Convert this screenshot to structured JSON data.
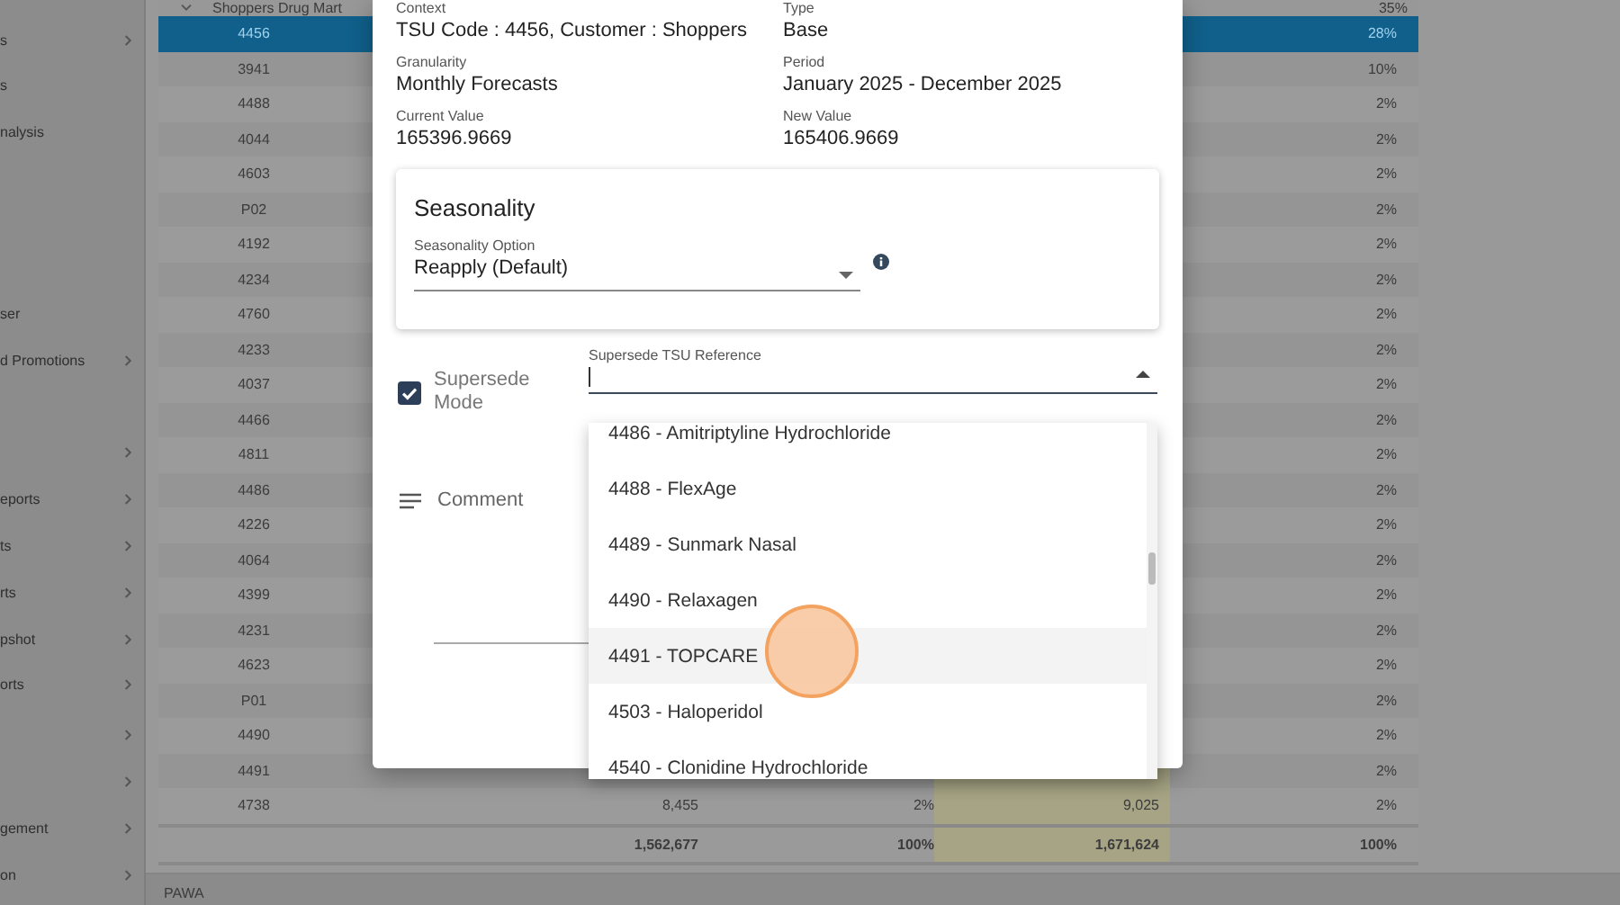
{
  "sidebar": {
    "items": [
      {
        "label": "s",
        "expandable": true
      },
      {
        "label": "s",
        "expandable": false
      },
      {
        "label": "nalysis",
        "expandable": false
      },
      {
        "label": "ser",
        "expandable": false
      },
      {
        "label": "d Promotions",
        "expandable": true
      },
      {
        "expandable": true
      },
      {
        "label": "eports",
        "expandable": true
      },
      {
        "label": "ts",
        "expandable": true
      },
      {
        "label": "rts",
        "expandable": true
      },
      {
        "label": "pshot",
        "expandable": true
      },
      {
        "label": "orts",
        "expandable": true
      },
      {
        "expandable": true
      },
      {
        "expandable": true
      },
      {
        "label": "gement",
        "expandable": true
      },
      {
        "label": "on",
        "expandable": true
      }
    ]
  },
  "table": {
    "group": {
      "name": "Shoppers Drug Mart",
      "share": "35%",
      "expanded": true
    },
    "rows": [
      {
        "code": "4456",
        "share": "28%",
        "selected": true
      },
      {
        "code": "3941",
        "share": "10%",
        "selected": false
      },
      {
        "code": "4488",
        "share": "2%",
        "selected": false
      },
      {
        "code": "4044",
        "share": "2%",
        "selected": false
      },
      {
        "code": "4603",
        "share": "2%",
        "selected": false
      },
      {
        "code": "P02",
        "share": "2%",
        "selected": false
      },
      {
        "code": "4192",
        "share": "2%",
        "selected": false
      },
      {
        "code": "4234",
        "share": "2%",
        "selected": false
      },
      {
        "code": "4760",
        "share": "2%",
        "selected": false
      },
      {
        "code": "4233",
        "share": "2%",
        "selected": false
      },
      {
        "code": "4037",
        "share": "2%",
        "selected": false
      },
      {
        "code": "4466",
        "share": "2%",
        "selected": false
      },
      {
        "code": "4811",
        "share": "2%",
        "selected": false
      },
      {
        "code": "4486",
        "share": "2%",
        "selected": false
      },
      {
        "code": "4226",
        "share": "2%",
        "selected": false
      },
      {
        "code": "4064",
        "share": "2%",
        "selected": false
      },
      {
        "code": "4399",
        "share": "2%",
        "selected": false
      },
      {
        "code": "4231",
        "share": "2%",
        "selected": false
      },
      {
        "code": "4623",
        "share": "2%",
        "selected": false
      },
      {
        "code": "P01",
        "share": "2%",
        "selected": false
      },
      {
        "code": "4490",
        "share": "2%",
        "selected": false
      },
      {
        "code": "4491",
        "share": "2%",
        "selected": false
      },
      {
        "code": "4738",
        "share": "2%",
        "selected": false,
        "column_3": "8,455",
        "column_4": "2%",
        "column_5": "9,025"
      }
    ],
    "totals": {
      "column_3": "1,562,677",
      "column_4": "100%",
      "column_5": "1,671,624",
      "share": "100%"
    }
  },
  "footer": {
    "text": "PAWA"
  },
  "dialog": {
    "fields": [
      {
        "label": "Context",
        "value": "TSU Code  : 4456, Customer : Shoppers"
      },
      {
        "label": "Type",
        "value": "Base"
      },
      {
        "label": "Granularity",
        "value": "Monthly Forecasts"
      },
      {
        "label": "Period",
        "value": "January 2025 - December 2025"
      },
      {
        "label": "Current Value",
        "value": "165396.9669"
      },
      {
        "label": "New Value",
        "value": "165406.9669"
      }
    ],
    "seasonality": {
      "title": "Seasonality",
      "option_label": "Seasonality Option",
      "option_value": "Reapply (Default)"
    },
    "supersede": {
      "checked": true,
      "label": "Supersede Mode",
      "reference_label": "Supersede TSU Reference",
      "open": true
    },
    "comment": {
      "label": "Comment"
    },
    "options": [
      {
        "label": "4486 - Amitriptyline Hydrochloride",
        "highlighted": false
      },
      {
        "label": "4488 - FlexAge",
        "highlighted": false
      },
      {
        "label": "4489 - Sunmark Nasal",
        "highlighted": false
      },
      {
        "label": "4490 - Relaxagen",
        "highlighted": false
      },
      {
        "label": "4491 - TOPCARE",
        "highlighted": true
      },
      {
        "label": "4503 - Haloperidol",
        "highlighted": false
      },
      {
        "label": "4540 - Clonidine Hydrochloride",
        "highlighted": false
      }
    ]
  }
}
